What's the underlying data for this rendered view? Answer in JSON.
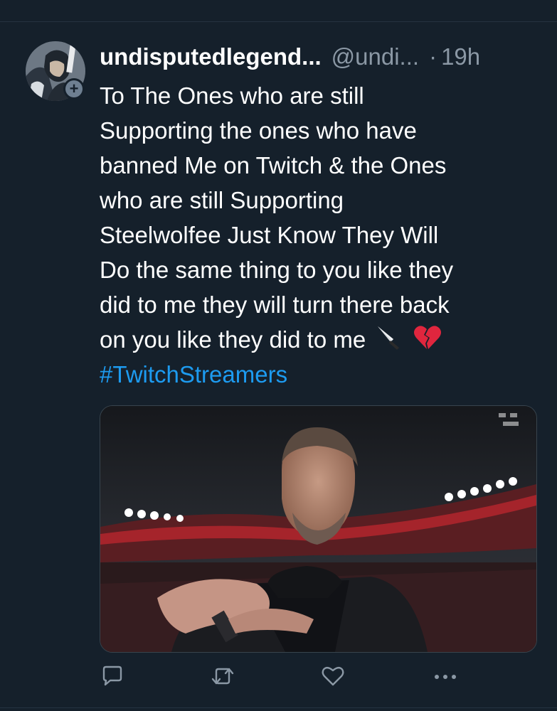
{
  "tweet": {
    "display_name": "undisputedlegend...",
    "handle": "@undi...",
    "separator": "·",
    "time": "19h",
    "lines": [
      "To The Ones who are still",
      "Supporting the ones who have",
      "banned Me on Twitch  & the Ones",
      "who are still Supporting",
      "Steelwolfee Just Know They Will",
      "Do the same thing to you like they",
      "did to me they will turn there back",
      "on you like they did to me"
    ],
    "emojis": [
      "🔪",
      "💔"
    ],
    "hashtag": "#TwitchStreamers"
  },
  "follow_badge": "+",
  "actions": {
    "reply_icon": "reply-icon",
    "retweet_icon": "retweet-icon",
    "like_icon": "heart-icon",
    "more_icon": "more-icon"
  },
  "colors": {
    "background": "#15202b",
    "text": "#ffffff",
    "secondary": "#8b98a5",
    "link": "#1d9bf0",
    "icon": "#8b98a5"
  }
}
